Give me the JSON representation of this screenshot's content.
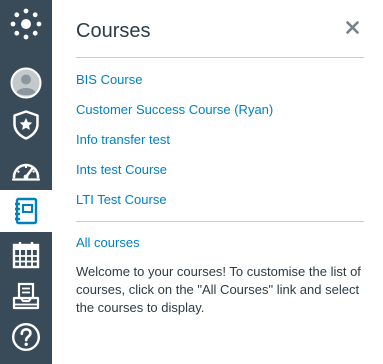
{
  "nav": {
    "items": [
      {
        "name": "institution-logo",
        "icon": "canvas-logo-icon",
        "active": false
      },
      {
        "name": "account",
        "icon": "avatar-icon",
        "active": false
      },
      {
        "name": "admin",
        "icon": "shield-star-icon",
        "active": false
      },
      {
        "name": "dashboard",
        "icon": "gauge-icon",
        "active": false
      },
      {
        "name": "courses",
        "icon": "courses-icon",
        "active": true
      },
      {
        "name": "calendar",
        "icon": "calendar-icon",
        "active": false
      },
      {
        "name": "inbox",
        "icon": "inbox-icon",
        "active": false
      },
      {
        "name": "help",
        "icon": "help-icon",
        "active": false
      }
    ]
  },
  "tray": {
    "title": "Courses",
    "close_icon": "close-icon",
    "courses": [
      "BIS Course",
      "Customer Success Course (Ryan)",
      "Info transfer test",
      "Ints test Course",
      "LTI Test Course"
    ],
    "all_courses_label": "All courses",
    "welcome_text": "Welcome to your courses! To customise the list of courses, click on the \"All Courses\" link and select the courses to display."
  },
  "colors": {
    "rail_bg": "#394b58",
    "active_icon": "#0081bd",
    "link": "#0081bd",
    "text": "#2d3b45"
  }
}
